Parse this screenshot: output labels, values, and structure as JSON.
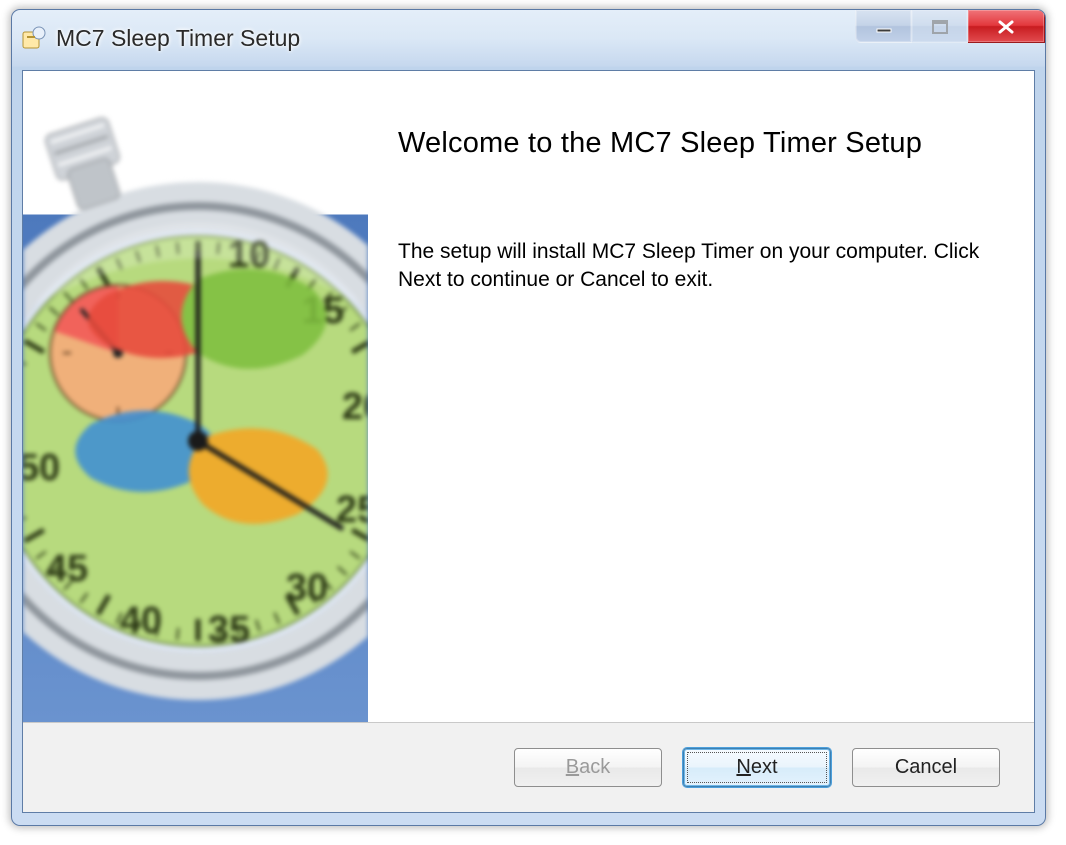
{
  "window": {
    "title": "MC7 Sleep Timer Setup"
  },
  "wizard": {
    "heading": "Welcome to the MC7 Sleep Timer Setup",
    "body_text": "The setup will install MC7 Sleep Timer on your computer. Click Next to continue or Cancel to exit."
  },
  "buttons": {
    "back": "Back",
    "next": "Next",
    "cancel": "Cancel"
  },
  "caption": {
    "minimize": "Minimize",
    "maximize": "Maximize",
    "close": "Close"
  }
}
